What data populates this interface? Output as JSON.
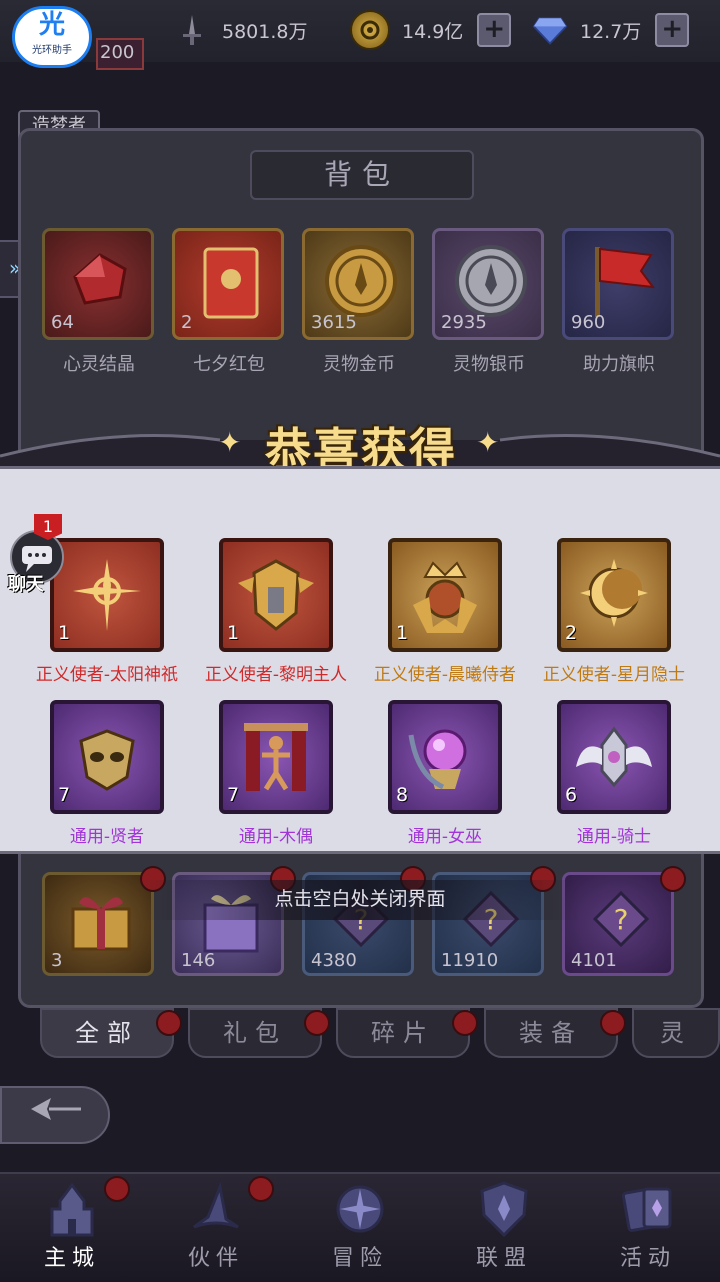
{
  "top_bar": {
    "app_badge": {
      "glyph": "光",
      "label": "光环助手"
    },
    "player_level": "200",
    "player_title": "造梦者",
    "resources": [
      {
        "icon": "sword-icon",
        "value": "5801.8万"
      },
      {
        "icon": "gold-coin-icon",
        "value": "14.9亿"
      },
      {
        "icon": "diamond-icon",
        "value": "12.7万"
      }
    ],
    "plus_label": "+"
  },
  "backpack": {
    "title": "背包",
    "items_row1": [
      {
        "name": "心灵结晶",
        "count": "64",
        "icon": "crystal-icon"
      },
      {
        "name": "七夕红包",
        "count": "2",
        "icon": "red-envelope-icon"
      },
      {
        "name": "灵物金币",
        "count": "3615",
        "icon": "gold-coin-icon"
      },
      {
        "name": "灵物银币",
        "count": "2935",
        "icon": "silver-coin-icon"
      },
      {
        "name": "助力旗帜",
        "count": "960",
        "icon": "flag-icon"
      }
    ],
    "items_bottom_row": [
      {
        "count": "3",
        "icon": "gift-box-icon"
      },
      {
        "count": "146",
        "icon": "gift-bag-icon"
      },
      {
        "count": "4380",
        "icon": "mystery-shard-icon"
      },
      {
        "count": "11910",
        "icon": "mystery-shard-icon"
      },
      {
        "count": "4101",
        "icon": "mystery-shard-icon"
      }
    ],
    "tabs": [
      "全部",
      "礼包",
      "碎片",
      "装备",
      "灵"
    ]
  },
  "reward_popup": {
    "title": "恭喜获得",
    "items": [
      {
        "name": "正义使者-太阳神祇",
        "qty": "1",
        "rarity": "red",
        "icon": "sun-emblem-icon"
      },
      {
        "name": "正义使者-黎明主人",
        "qty": "1",
        "rarity": "red",
        "icon": "helmet-emblem-icon"
      },
      {
        "name": "正义使者-晨曦侍者",
        "qty": "1",
        "rarity": "gold",
        "icon": "crown-emblem-icon"
      },
      {
        "name": "正义使者-星月隐士",
        "qty": "2",
        "rarity": "gold",
        "icon": "moon-emblem-icon"
      },
      {
        "name": "通用-贤者",
        "qty": "7",
        "rarity": "purple",
        "icon": "mask-emblem-icon"
      },
      {
        "name": "通用-木偶",
        "qty": "7",
        "rarity": "purple",
        "icon": "puppet-emblem-icon"
      },
      {
        "name": "通用-女巫",
        "qty": "8",
        "rarity": "purple",
        "icon": "orb-emblem-icon"
      },
      {
        "name": "通用-骑士",
        "qty": "6",
        "rarity": "purple",
        "icon": "winged-crown-emblem-icon"
      }
    ],
    "close_hint": "点击空白处关闭界面"
  },
  "chat": {
    "label": "聊天",
    "badge": "1"
  },
  "nav": [
    {
      "label": "主城",
      "icon": "castle-icon",
      "active": true
    },
    {
      "label": "伙伴",
      "icon": "witch-hat-icon"
    },
    {
      "label": "冒险",
      "icon": "compass-icon"
    },
    {
      "label": "联盟",
      "icon": "shield-icon"
    },
    {
      "label": "活动",
      "icon": "cards-icon"
    }
  ],
  "colors": {
    "red_rarity": "#d02a2a",
    "gold_rarity": "#c07a12",
    "purple_rarity": "#a235d8",
    "title_gold": "#f6dc8c"
  }
}
